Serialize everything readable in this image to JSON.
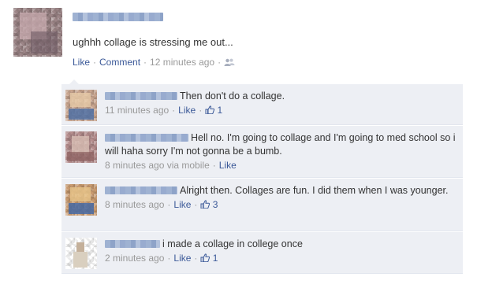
{
  "post": {
    "text": "ughhh collage is stressing me out...",
    "like_label": "Like",
    "comment_label": "Comment",
    "timestamp": "12 minutes ago",
    "separator": "·",
    "privacy_icon": "friends-icon"
  },
  "comments": [
    {
      "text": "Then don't do a collage.",
      "timestamp": "11 minutes ago",
      "like_label": "Like",
      "like_count": "1",
      "via": ""
    },
    {
      "text": "Hell no. I'm going to collage and I'm going to med school so i will haha sorry I'm not gonna be a bumb.",
      "timestamp": "8 minutes ago via mobile",
      "like_label": "Like",
      "like_count": ""
    },
    {
      "text": "Alright then. Collages are fun. I did them when I was younger.",
      "timestamp": "8 minutes ago",
      "like_label": "Like",
      "like_count": "3"
    },
    {
      "text": "i made a collage in college once",
      "timestamp": "2 minutes ago",
      "like_label": "Like",
      "like_count": "1"
    }
  ],
  "colors": {
    "link": "#3b5998",
    "meta": "#999999",
    "comment_bg": "#edeff4"
  }
}
